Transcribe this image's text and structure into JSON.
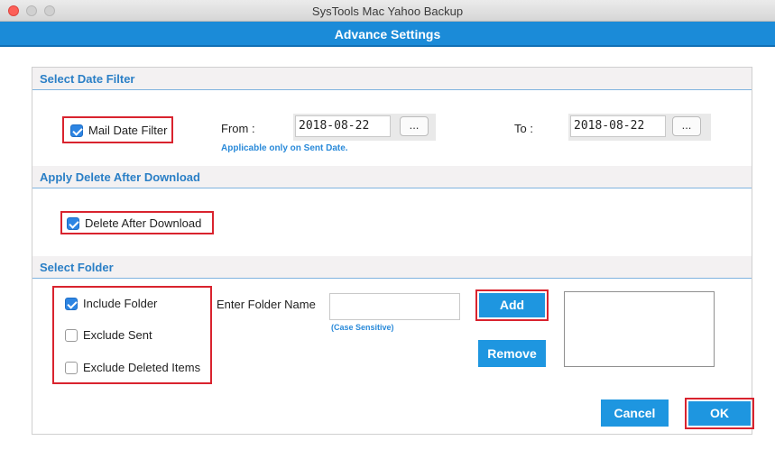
{
  "window": {
    "title": "SysTools Mac Yahoo Backup"
  },
  "header": {
    "title": "Advance Settings"
  },
  "date_filter": {
    "section_title": "Select Date Filter",
    "checkbox_label": "Mail Date Filter",
    "checked": true,
    "from_label": "From :",
    "from_value": "2018-08-22",
    "to_label": "To :",
    "to_value": "2018-08-22",
    "picker_label": "...",
    "note": "Applicable only on Sent Date."
  },
  "delete_after": {
    "section_title": "Apply Delete After Download",
    "checkbox_label": "Delete After Download",
    "checked": true
  },
  "folder": {
    "section_title": "Select Folder",
    "options": [
      {
        "label": "Include Folder",
        "checked": true
      },
      {
        "label": "Exclude Sent",
        "checked": false
      },
      {
        "label": "Exclude Deleted Items",
        "checked": false
      }
    ],
    "name_label": "Enter Folder Name",
    "name_value": "",
    "case_note": "(Case Sensitive)",
    "add_label": "Add",
    "remove_label": "Remove"
  },
  "footer": {
    "cancel_label": "Cancel",
    "ok_label": "OK"
  },
  "colors": {
    "accent": "#1e96e0",
    "header": "#1b8bd8",
    "highlight": "#d9232e",
    "section_text": "#2a7fc6"
  },
  "icons": {
    "checkbox_checked": "check-icon"
  }
}
